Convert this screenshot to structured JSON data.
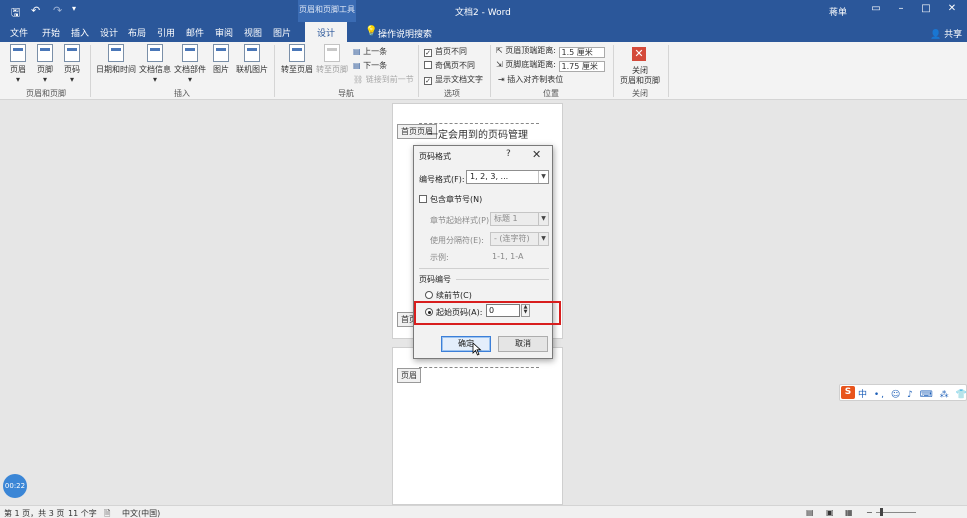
{
  "titlebar": {
    "context_tool": "页眉和页脚工具",
    "doc_title": "文档2 - Word",
    "user": "蒋单",
    "accent": "#2b579a"
  },
  "tabs": [
    {
      "label": "文件"
    },
    {
      "label": "开始"
    },
    {
      "label": "插入"
    },
    {
      "label": "设计"
    },
    {
      "label": "布局"
    },
    {
      "label": "引用"
    },
    {
      "label": "邮件"
    },
    {
      "label": "审阅"
    },
    {
      "label": "视图"
    },
    {
      "label": "图片"
    },
    {
      "label": "设计"
    }
  ],
  "tellme": "操作说明搜索",
  "share": "共享",
  "ribbon": {
    "group1": {
      "label": "页眉和页脚",
      "buttons": [
        "页眉",
        "页脚",
        "页码"
      ]
    },
    "group2": {
      "label": "插入",
      "buttons": [
        "日期和时间",
        "文档信息",
        "文档部件",
        "图片",
        "联机图片"
      ]
    },
    "group3": {
      "label": "导航",
      "buttons": [
        "转至页眉",
        "转至页脚"
      ],
      "small": [
        "上一条",
        "下一条",
        "链接到前一节"
      ]
    },
    "group4": {
      "label": "选项",
      "checks": [
        {
          "label": "首页不同",
          "checked": true
        },
        {
          "label": "奇偶页不同",
          "checked": false
        },
        {
          "label": "显示文档文字",
          "checked": true
        }
      ]
    },
    "group5": {
      "label": "位置",
      "header_dist_label": "页眉顶端距离:",
      "header_dist_value": "1.5 厘米",
      "footer_dist_label": "页脚底端距离:",
      "footer_dist_value": "1.75 厘米",
      "insert_tab": "插入对齐制表位"
    },
    "group6": {
      "label": "关闭",
      "close_line1": "关闭",
      "close_line2": "页眉和页脚"
    }
  },
  "document": {
    "first_header_tag": "首页页眉",
    "first_footer_tag": "首页",
    "header_tag": "页眉",
    "body_text": "一定会用到的页码管理"
  },
  "dialog": {
    "title": "页码格式",
    "help": "?",
    "close": "✕",
    "number_format_label": "编号格式(F):",
    "number_format_value": "1, 2, 3, ...",
    "include_chapter_label": "包含章节号(N)",
    "chapter_style_label": "章节起始样式(P)",
    "chapter_style_value": "标题 1",
    "separator_label": "使用分隔符(E):",
    "separator_value": "-  (连字符)",
    "example_label": "示例:",
    "example_value": "1-1, 1-A",
    "page_numbering_label": "页码编号",
    "continue_label": "续前节(C)",
    "start_at_label": "起始页码(A):",
    "start_at_value": "0",
    "ok_label": "确定",
    "cancel_label": "取消"
  },
  "statusbar": {
    "page_info": "第 1 页，共 3 页",
    "word_count": "11 个字",
    "language": "中文(中国)"
  },
  "timer": "00:22",
  "ime": {
    "logo": "S",
    "text": "中 •, ☺ ♪ ⌨ ⁂ 👕 ✔"
  }
}
